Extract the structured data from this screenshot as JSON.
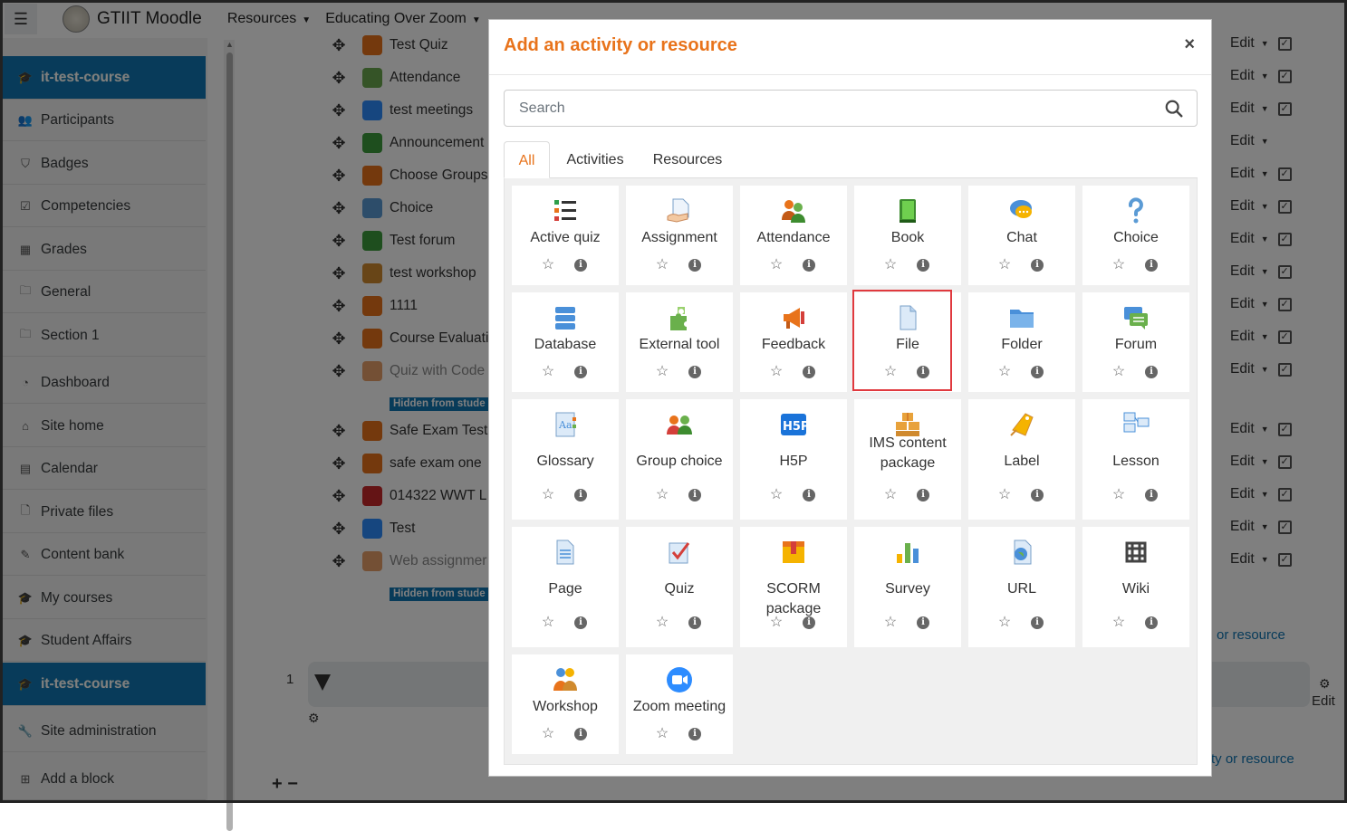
{
  "navbar": {
    "brand": "GTIIT Moodle",
    "menu": [
      "Resources",
      "Educating Over Zoom"
    ]
  },
  "sidebar": {
    "items": [
      {
        "label": "it-test-course",
        "icon": "graduation-cap-icon",
        "glyph": "🎓",
        "active": true
      },
      {
        "label": "Participants",
        "icon": "users-icon",
        "glyph": "👥"
      },
      {
        "label": "Badges",
        "icon": "shield-icon",
        "glyph": "⛉"
      },
      {
        "label": "Competencies",
        "icon": "check-square-icon",
        "glyph": "☑"
      },
      {
        "label": "Grades",
        "icon": "table-icon",
        "glyph": "▦"
      },
      {
        "label": "General",
        "icon": "folder-icon",
        "glyph": "🗀"
      },
      {
        "label": "Section 1",
        "icon": "folder-icon",
        "glyph": "🗀"
      },
      {
        "label": "Dashboard",
        "icon": "dashboard-icon",
        "glyph": "◔"
      },
      {
        "label": "Site home",
        "icon": "home-icon",
        "glyph": "⌂"
      },
      {
        "label": "Calendar",
        "icon": "calendar-icon",
        "glyph": "▤"
      },
      {
        "label": "Private files",
        "icon": "file-icon",
        "glyph": "🗋"
      },
      {
        "label": "Content bank",
        "icon": "brush-icon",
        "glyph": "✎"
      },
      {
        "label": "My courses",
        "icon": "graduation-cap-icon",
        "glyph": "🎓"
      },
      {
        "label": "Student Affairs",
        "icon": "graduation-cap-icon",
        "glyph": "🎓"
      },
      {
        "label": "it-test-course",
        "icon": "graduation-cap-icon",
        "glyph": "🎓",
        "active": true
      },
      {
        "label": "Site administration",
        "icon": "wrench-icon",
        "glyph": "🔧"
      },
      {
        "label": "Add a block",
        "icon": "plus-square-icon",
        "glyph": "⊞"
      }
    ]
  },
  "course": {
    "activities": [
      {
        "label": "Test Quiz",
        "color": "#e8731b"
      },
      {
        "label": "Attendance",
        "color": "#6aa84f"
      },
      {
        "label": "test meetings",
        "color": "#2d8cff"
      },
      {
        "label": "Announcement",
        "color": "#3d9c3d"
      },
      {
        "label": "Choose Groups",
        "color": "#e8731b"
      },
      {
        "label": "Choice",
        "color": "#5b9bd5"
      },
      {
        "label": "Test forum",
        "color": "#3d9c3d"
      },
      {
        "label": "test workshop",
        "color": "#d08a2e"
      },
      {
        "label": "1111",
        "color": "#e8731b"
      },
      {
        "label": "Course Evaluati",
        "color": "#e8731b"
      },
      {
        "label": "Quiz with Code",
        "color": "#e8a06a",
        "dim": true
      },
      {
        "label": "Safe Exam Test",
        "color": "#e8731b"
      },
      {
        "label": "safe exam one",
        "color": "#e8731b"
      },
      {
        "label": "014322 WWT L",
        "color": "#c8282b"
      },
      {
        "label": "Test",
        "color": "#2d8cff"
      },
      {
        "label": "Web assignmer",
        "color": "#e8a06a",
        "dim": true
      }
    ],
    "hidden_badge": "Hidden from stude",
    "edit_label": "Edit",
    "section_number": "1",
    "add_activity_text_1": "or resource",
    "add_activity_text_2": "ty or resource",
    "section_edit": "Edit"
  },
  "modal": {
    "title": "Add an activity or resource",
    "close": "×",
    "search_placeholder": "Search",
    "tabs": [
      "All",
      "Activities",
      "Resources"
    ],
    "active_tab": "All",
    "highlighted": "File",
    "items": [
      {
        "label": "Active quiz",
        "icon": "active-quiz-icon"
      },
      {
        "label": "Assignment",
        "icon": "assignment-icon"
      },
      {
        "label": "Attendance",
        "icon": "attendance-icon"
      },
      {
        "label": "Book",
        "icon": "book-icon"
      },
      {
        "label": "Chat",
        "icon": "chat-icon"
      },
      {
        "label": "Choice",
        "icon": "choice-icon"
      },
      {
        "label": "Database",
        "icon": "database-icon"
      },
      {
        "label": "External tool",
        "icon": "external-tool-icon"
      },
      {
        "label": "Feedback",
        "icon": "feedback-icon"
      },
      {
        "label": "File",
        "icon": "file-icon"
      },
      {
        "label": "Folder",
        "icon": "folder-icon"
      },
      {
        "label": "Forum",
        "icon": "forum-icon"
      },
      {
        "label": "Glossary",
        "icon": "glossary-icon"
      },
      {
        "label": "Group choice",
        "icon": "group-choice-icon"
      },
      {
        "label": "H5P",
        "icon": "h5p-icon"
      },
      {
        "label": "IMS content package",
        "icon": "ims-package-icon"
      },
      {
        "label": "Label",
        "icon": "label-icon"
      },
      {
        "label": "Lesson",
        "icon": "lesson-icon"
      },
      {
        "label": "Page",
        "icon": "page-icon"
      },
      {
        "label": "Quiz",
        "icon": "quiz-icon"
      },
      {
        "label": "SCORM package",
        "icon": "scorm-icon"
      },
      {
        "label": "Survey",
        "icon": "survey-icon"
      },
      {
        "label": "URL",
        "icon": "url-icon"
      },
      {
        "label": "Wiki",
        "icon": "wiki-icon"
      },
      {
        "label": "Workshop",
        "icon": "workshop-icon"
      },
      {
        "label": "Zoom meeting",
        "icon": "zoom-icon"
      }
    ]
  },
  "colors": {
    "accent": "#e8731b",
    "sidebar_active": "#1177b5",
    "highlight": "#e0393e"
  }
}
